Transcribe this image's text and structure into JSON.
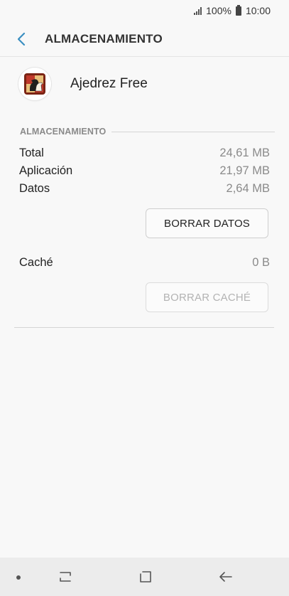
{
  "status_bar": {
    "battery": "100%",
    "time": "10:00"
  },
  "app_bar": {
    "title": "ALMACENAMIENTO"
  },
  "app": {
    "name": "Ajedrez Free"
  },
  "storage": {
    "section_label": "ALMACENAMIENTO",
    "rows": [
      {
        "label": "Total",
        "value": "24,61 MB"
      },
      {
        "label": "Aplicación",
        "value": "21,97 MB"
      },
      {
        "label": "Datos",
        "value": "2,64 MB"
      }
    ],
    "clear_data_label": "BORRAR DATOS"
  },
  "cache": {
    "label": "Caché",
    "value": "0 B",
    "clear_cache_label": "BORRAR CACHÉ"
  },
  "colors": {
    "accent": "#3a8fc1",
    "background": "#f8f8f8",
    "secondary_text": "#8a8a8a"
  }
}
